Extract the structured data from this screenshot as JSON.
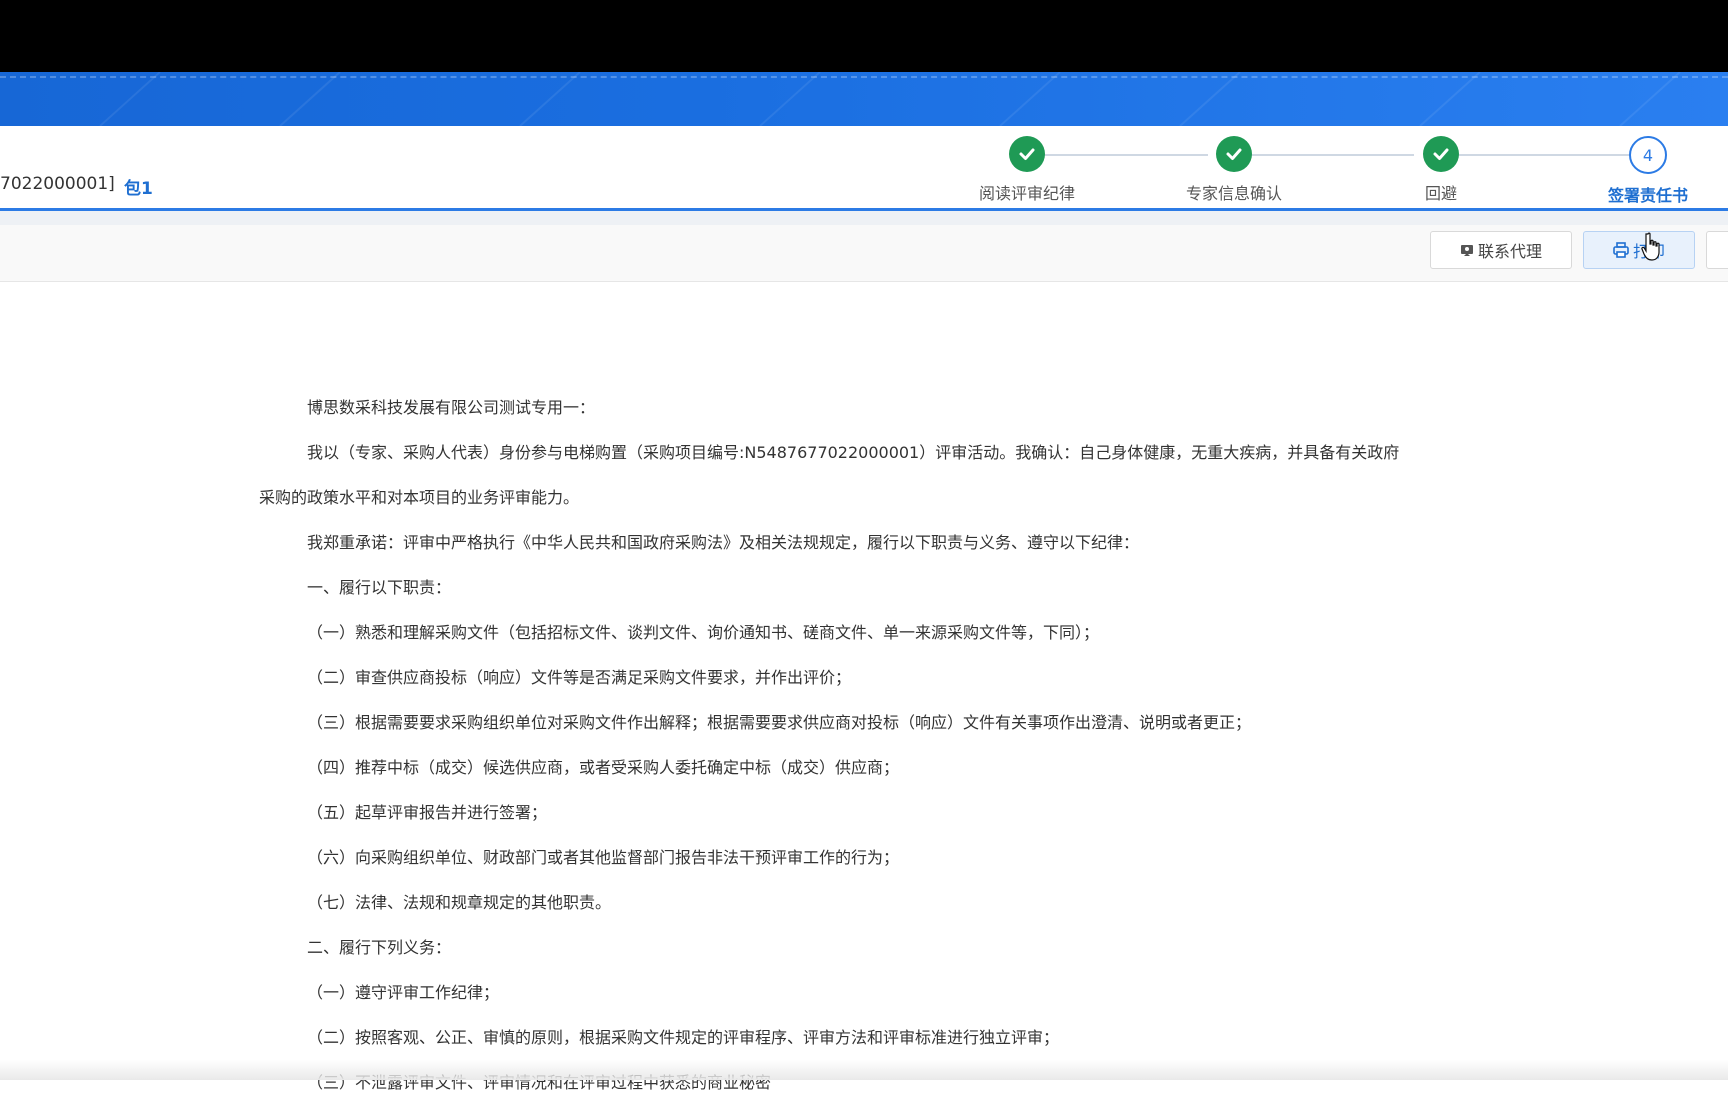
{
  "header": {
    "project_code": "7022000001]",
    "package": "包1"
  },
  "steps": [
    {
      "label": "阅读评审纪律",
      "status": "done"
    },
    {
      "label": "专家信息确认",
      "status": "done"
    },
    {
      "label": "回避",
      "status": "done"
    },
    {
      "label": "签署责任书",
      "status": "current",
      "number": "4"
    }
  ],
  "toolbar": {
    "contact_agent_label": "联系代理",
    "print_label": "打印"
  },
  "document": {
    "lines": [
      "博思数采科技发展有限公司测试专用一：",
      "我以（专家、采购人代表）身份参与电梯购置（采购项目编号:N5487677022000001）评审活动。我确认：自己身体健康，无重大疾病，并具备有关政府",
      "采购的政策水平和对本项目的业务评审能力。",
      "我郑重承诺：评审中严格执行《中华人民共和国政府采购法》及相关法规规定，履行以下职责与义务、遵守以下纪律：",
      "一、履行以下职责：",
      "（一）熟悉和理解采购文件（包括招标文件、谈判文件、询价通知书、磋商文件、单一来源采购文件等，下同）；",
      "（二）审查供应商投标（响应）文件等是否满足采购文件要求，并作出评价；",
      "（三）根据需要要求采购组织单位对采购文件作出解释；根据需要要求供应商对投标（响应）文件有关事项作出澄清、说明或者更正；",
      "（四）推荐中标（成交）候选供应商，或者受采购人委托确定中标（成交）供应商；",
      "（五）起草评审报告并进行签署；",
      "（六）向采购组织单位、财政部门或者其他监督部门报告非法干预评审工作的行为；",
      "（七）法律、法规和规章规定的其他职责。",
      "二、履行下列义务：",
      "（一）遵守评审工作纪律；",
      "（二）按照客观、公正、审慎的原则，根据采购文件规定的评审程序、评审方法和评审标准进行独立评审；",
      "（三）不泄露评审文件、评审情况和在评审过程中获悉的商业秘密"
    ]
  },
  "colors": {
    "banner_blue": "#1a6ee0",
    "step_done_green": "#1f9a55",
    "accent_blue": "#2c7be5"
  }
}
